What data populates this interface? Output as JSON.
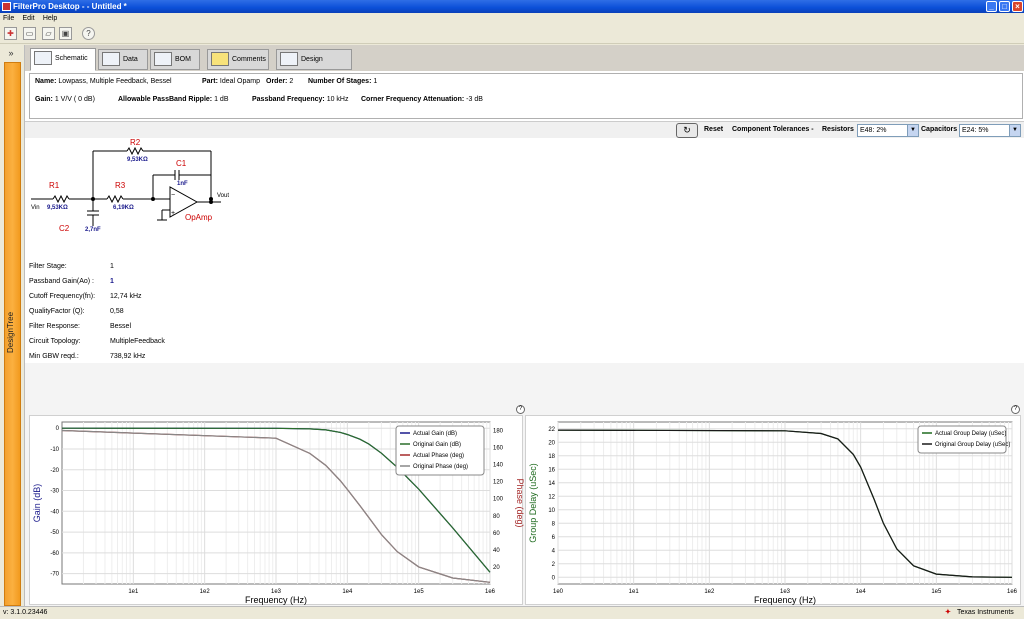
{
  "window": {
    "title": "FilterPro Desktop -  - Untitled *"
  },
  "menu": [
    "File",
    "Edit",
    "Help"
  ],
  "toolbar": {
    "help": "?"
  },
  "sidebar": {
    "label": "DesignTree",
    "collapse": "»"
  },
  "tabs": [
    "Schematic",
    "Data",
    "BOM",
    "Comments",
    "Design Report"
  ],
  "info": {
    "name_label": "Name:",
    "name_value": "Lowpass, Multiple Feedback, Bessel",
    "part_label": "Part:",
    "part_value": "Ideal Opamp",
    "order_label": "Order:",
    "order_value": "2",
    "stages_label": "Number Of Stages:",
    "stages_value": "1",
    "gain_label": "Gain:",
    "gain_value": "1 V/V ( 0 dB)",
    "ripple_label": "Allowable PassBand Ripple:",
    "ripple_value": "1 dB",
    "pbfreq_label": "Passband Frequency:",
    "pbfreq_value": "10 kHz",
    "corner_label": "Corner Frequency Attenuation:",
    "corner_value": "-3 dB"
  },
  "controls": {
    "reset": "Reset",
    "tolerances": "Component Tolerances -",
    "resistors_label": "Resistors",
    "resistors_value": "E48: 2%",
    "capacitors_label": "Capacitors",
    "capacitors_value": "E24: 5%"
  },
  "schematic": {
    "R1": "R1",
    "R1_val": "9,53KΩ",
    "R2": "R2",
    "R2_val": "9,53KΩ",
    "R3": "R3",
    "R3_val": "6,19KΩ",
    "C1": "C1",
    "C1_val": "1nF",
    "C2": "C2",
    "C2_val": "2,7nF",
    "opamp": "OpAmp",
    "vin": "Vin",
    "vout": "Vout"
  },
  "params": [
    {
      "label": "Filter Stage:",
      "value": "1"
    },
    {
      "label": "Passband Gain(Ao) :",
      "value": "1"
    },
    {
      "label": "Cutoff Frequency(fn):",
      "value": "12,74 kHz"
    },
    {
      "label": "QualityFactor (Q):",
      "value": "0,58"
    },
    {
      "label": "Filter Response:",
      "value": "Bessel"
    },
    {
      "label": "Circuit Topology:",
      "value": "MultipleFeedback"
    },
    {
      "label": "Min GBW reqd.:",
      "value": "738,92 kHz"
    }
  ],
  "chart_data": [
    {
      "type": "line",
      "xlabel": "Frequency (Hz)",
      "ylabel": "Gain (dB)",
      "y2label": "Phase (deg)",
      "xscale": "log",
      "xlim": [
        1,
        1000000
      ],
      "xticks": [
        "1e1",
        "1e2",
        "1e3",
        "1e4",
        "1e5",
        "1e6"
      ],
      "ylim": [
        -75,
        3
      ],
      "yticks": [
        "0",
        "-10",
        "-20",
        "-30",
        "-40",
        "-50",
        "-60",
        "-70"
      ],
      "y2lim": [
        0,
        190
      ],
      "y2ticks": [
        "180",
        "160",
        "140",
        "120",
        "100",
        "80",
        "60",
        "40",
        "20"
      ],
      "legend": "top-right",
      "grid": true,
      "x": [
        1,
        1000,
        3000,
        5000,
        8000,
        10000,
        15000,
        20000,
        30000,
        50000,
        100000,
        300000,
        1000000
      ],
      "series": [
        {
          "name": "Actual Gain (dB)",
          "color": "#1a1a8c",
          "axis": "left",
          "values": [
            0,
            -0.03,
            -0.3,
            -0.8,
            -2.0,
            -3.0,
            -5.3,
            -7.6,
            -12.0,
            -18.8,
            -29.3,
            -48.0,
            -69.3
          ]
        },
        {
          "name": "Original Gain (dB)",
          "color": "#2a6e2a",
          "axis": "left",
          "values": [
            0,
            -0.03,
            -0.3,
            -0.8,
            -2.0,
            -3.0,
            -5.3,
            -7.6,
            -12.0,
            -18.8,
            -29.3,
            -48.0,
            -69.3
          ]
        },
        {
          "name": "Actual Phase (deg)",
          "color": "#a52a2a",
          "axis": "right",
          "values": [
            180,
            171,
            153,
            139,
            121,
            111,
            92,
            78,
            58,
            38,
            20,
            7,
            2
          ]
        },
        {
          "name": "Original Phase (deg)",
          "color": "#888888",
          "axis": "right",
          "values": [
            180,
            171,
            153,
            139,
            121,
            111,
            92,
            78,
            58,
            38,
            20,
            7,
            2
          ]
        }
      ]
    },
    {
      "type": "line",
      "xlabel": "Frequency (Hz)",
      "ylabel": "Group Delay (uSec)",
      "xscale": "log",
      "xlim": [
        1,
        1000000
      ],
      "xticks": [
        "1e0",
        "1e1",
        "1e2",
        "1e3",
        "1e4",
        "1e5",
        "1e6"
      ],
      "ylim": [
        -1,
        23
      ],
      "yticks": [
        "22",
        "20",
        "18",
        "16",
        "14",
        "12",
        "10",
        "8",
        "6",
        "4",
        "2",
        "0"
      ],
      "legend": "top-right",
      "grid": true,
      "x": [
        1,
        1000,
        3000,
        5000,
        8000,
        10000,
        15000,
        20000,
        30000,
        50000,
        100000,
        300000,
        1000000
      ],
      "series": [
        {
          "name": "Actual Group Delay (uSec)",
          "color": "#1f6b1f",
          "values": [
            21.8,
            21.7,
            21.3,
            20.5,
            18.2,
            16.3,
            11.6,
            8.0,
            4.2,
            1.7,
            0.46,
            0.05,
            0.0
          ]
        },
        {
          "name": "Original Group Delay (uSec)",
          "color": "#1a1a1a",
          "values": [
            21.8,
            21.7,
            21.3,
            20.5,
            18.2,
            16.3,
            11.6,
            8.0,
            4.2,
            1.7,
            0.46,
            0.05,
            0.0
          ]
        }
      ]
    }
  ],
  "status": {
    "version": "v: 3.1.0.23446",
    "vendor": "Texas Instruments"
  }
}
